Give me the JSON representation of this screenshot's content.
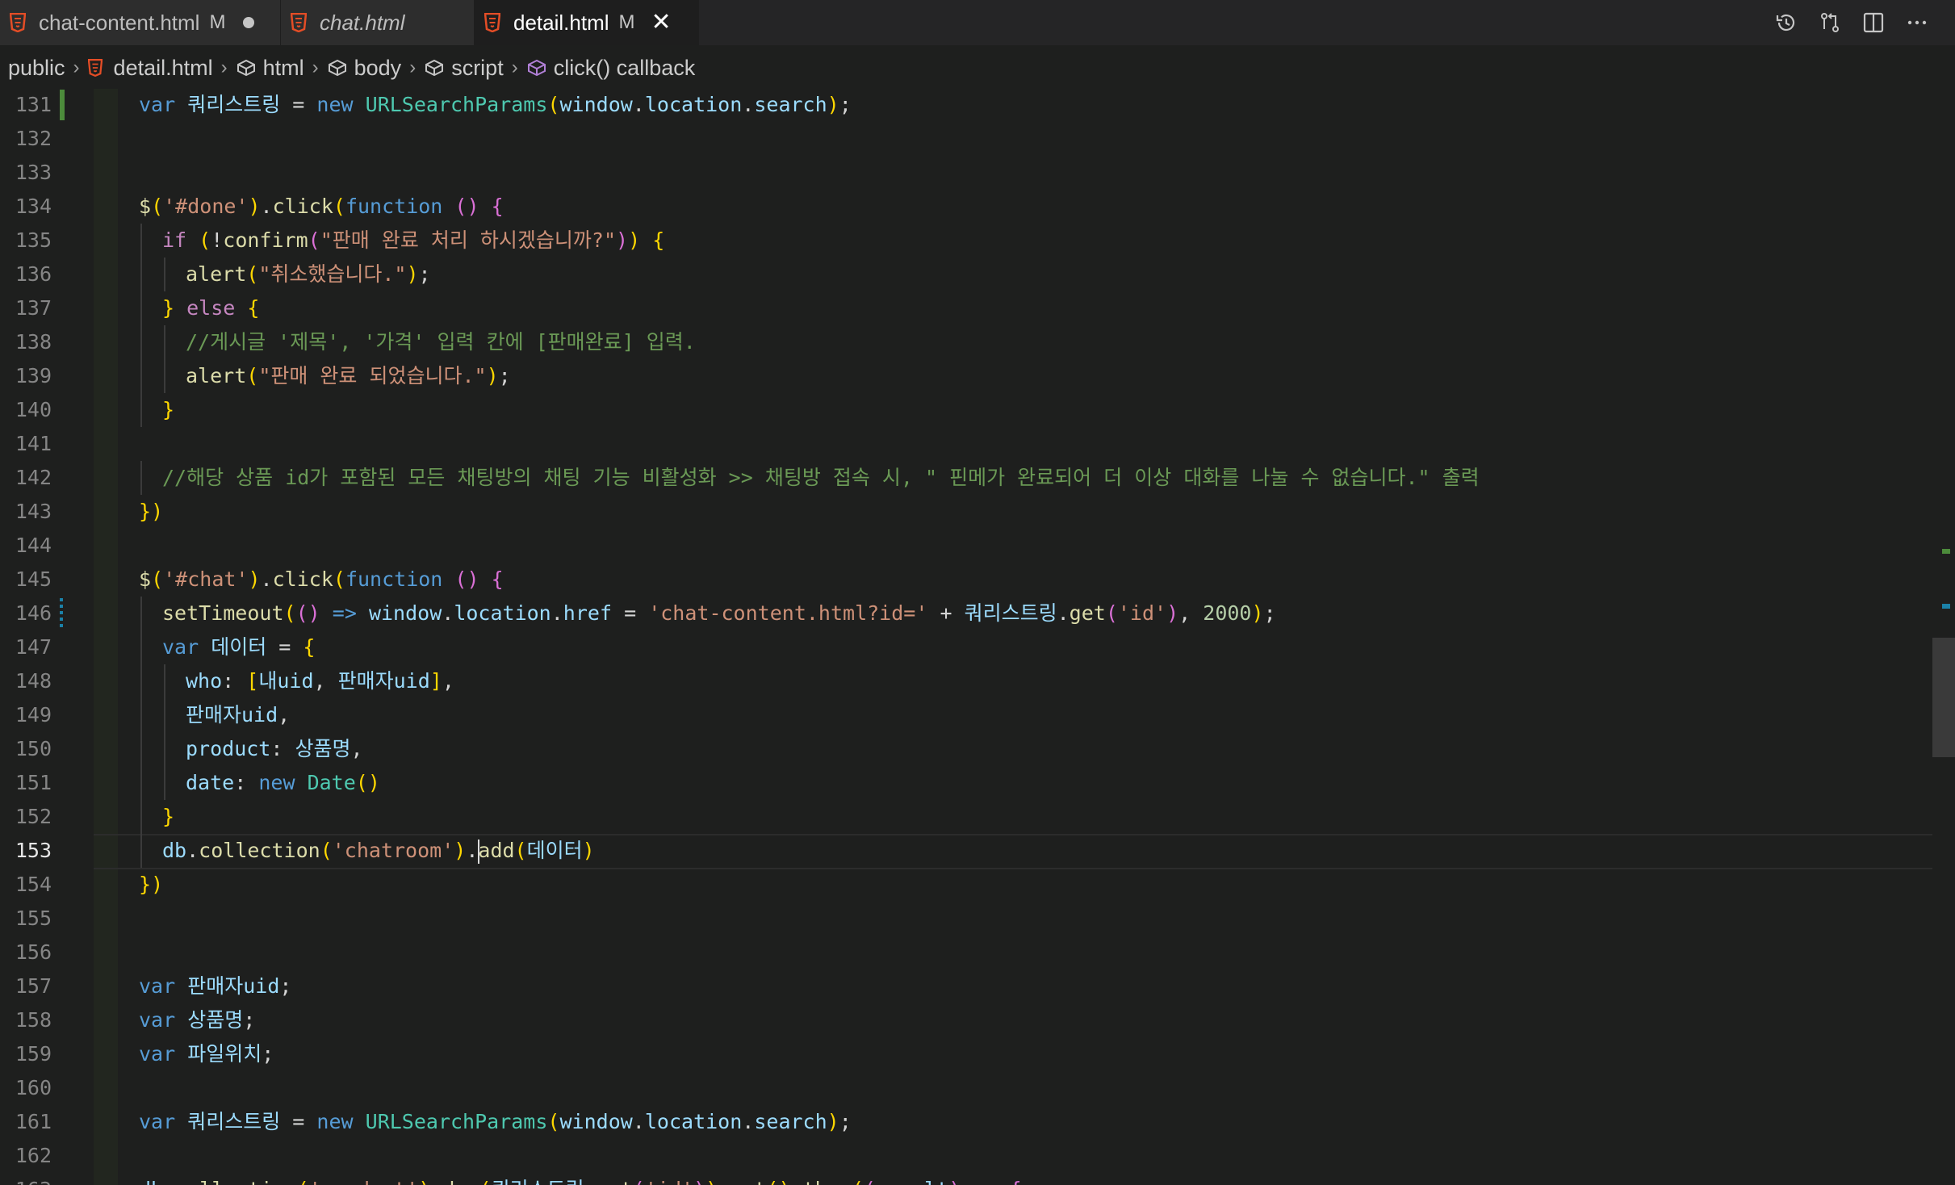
{
  "tabs": [
    {
      "name": "chat-content.html",
      "status": "M",
      "dirty": true,
      "active": false,
      "italic": false
    },
    {
      "name": "chat.html",
      "status": "",
      "dirty": false,
      "active": false,
      "italic": true
    },
    {
      "name": "detail.html",
      "status": "M",
      "dirty": false,
      "active": true,
      "italic": false,
      "close": "✕"
    }
  ],
  "breadcrumb": [
    "public",
    "detail.html",
    "html",
    "body",
    "script",
    "click() callback"
  ],
  "breadcrumb_sep": "›",
  "colors": {
    "accent_html": "#e44d26",
    "added": "#4c8b3b",
    "modified": "#1b81a8"
  },
  "editor": {
    "current_line": 153,
    "lines": [
      {
        "n": 131,
        "text": "var 쿼리스트링 = new URLSearchParams(window.location.search);"
      },
      {
        "n": 132,
        "text": ""
      },
      {
        "n": 133,
        "text": ""
      },
      {
        "n": 134,
        "text": "$('#done').click(function () {"
      },
      {
        "n": 135,
        "text": "if (!confirm(\"판매 완료 처리 하시겠습니까?\")) {"
      },
      {
        "n": 136,
        "text": "alert(\"취소했습니다.\");"
      },
      {
        "n": 137,
        "text": "} else {"
      },
      {
        "n": 138,
        "text": "//게시글 '제목', '가격' 입력 칸에 [판매완료] 입력."
      },
      {
        "n": 139,
        "text": "alert(\"판매 완료 되었습니다.\");"
      },
      {
        "n": 140,
        "text": "}"
      },
      {
        "n": 141,
        "text": ""
      },
      {
        "n": 142,
        "text": "//해당 상품 id가 포함된 모든 채팅방의 채팅 기능 비활성화 >> 채팅방 접속 시, \" 핀메가 완료되어 더 이상 대화를 나눌 수 없습니다.\" 출력"
      },
      {
        "n": 143,
        "text": "})"
      },
      {
        "n": 144,
        "text": ""
      },
      {
        "n": 145,
        "text": "$('#chat').click(function () {"
      },
      {
        "n": 146,
        "text": "setTimeout(() => window.location.href = 'chat-content.html?id=' + 쿼리스트링.get('id'), 2000);"
      },
      {
        "n": 147,
        "text": "var 데이터 = {"
      },
      {
        "n": 148,
        "text": "who: [내uid, 판매자uid],"
      },
      {
        "n": 149,
        "text": "판매자uid,"
      },
      {
        "n": 150,
        "text": "product: 상품명,"
      },
      {
        "n": 151,
        "text": "date: new Date()"
      },
      {
        "n": 152,
        "text": "}"
      },
      {
        "n": 153,
        "text": "db.collection('chatroom').add(데이터)"
      },
      {
        "n": 154,
        "text": "})"
      },
      {
        "n": 155,
        "text": ""
      },
      {
        "n": 156,
        "text": ""
      },
      {
        "n": 157,
        "text": "var 판매자uid;"
      },
      {
        "n": 158,
        "text": "var 상품명;"
      },
      {
        "n": 159,
        "text": "var 파일위치;"
      },
      {
        "n": 160,
        "text": ""
      },
      {
        "n": 161,
        "text": "var 쿼리스트링 = new URLSearchParams(window.location.search);"
      },
      {
        "n": 162,
        "text": ""
      },
      {
        "n": 163,
        "text": "db.collection('product').doc(쿼리스트링.get('id')).get().then((result) => {"
      }
    ]
  },
  "icons": {
    "history": "history-icon",
    "compare": "compare-changes-icon",
    "split": "split-editor-icon",
    "more": "more-actions-icon"
  }
}
